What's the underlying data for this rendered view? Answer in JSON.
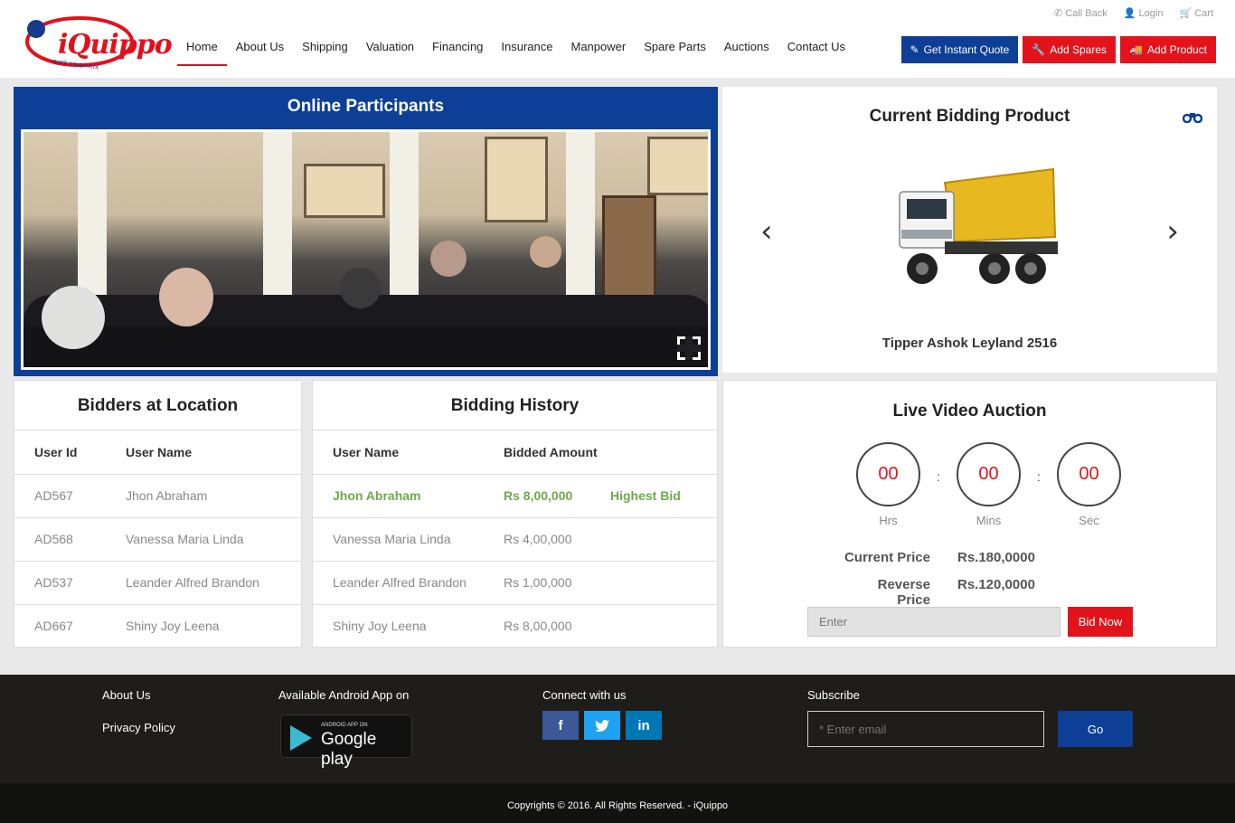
{
  "header": {
    "logo_text": "iQuippo",
    "logo_tagline": "quick equipment",
    "nav": [
      "Home",
      "About Us",
      "Shipping",
      "Valuation",
      "Financing",
      "Insurance",
      "Manpower",
      "Spare Parts",
      "Auctions",
      "Contact Us"
    ],
    "active_nav": "Home",
    "toplinks": {
      "call_back": "Call Back",
      "login": "Login",
      "cart": "Cart"
    },
    "buttons": {
      "quote": "Get Instant Quote",
      "spares": "Add Spares",
      "product": "Add Product"
    }
  },
  "online": {
    "title": "Online Participants"
  },
  "current": {
    "title": "Current Bidding Product",
    "product_name": "Tipper Ashok Leyland 2516"
  },
  "bidders": {
    "title": "Bidders at Location",
    "headers": [
      "User Id",
      "User Name"
    ],
    "rows": [
      [
        "AD567",
        "Jhon Abraham"
      ],
      [
        "AD568",
        "Vanessa Maria Linda"
      ],
      [
        "AD537",
        "Leander Alfred Brandon"
      ],
      [
        "AD667",
        "Shiny Joy Leena"
      ]
    ]
  },
  "history": {
    "title": "Bidding History",
    "headers": [
      "User Name",
      "Bidded Amount",
      ""
    ],
    "rows": [
      [
        "Jhon Abraham",
        "Rs 8,00,000",
        "Highest Bid"
      ],
      [
        "Vanessa Maria Linda",
        "Rs 4,00,000",
        ""
      ],
      [
        "Leander Alfred Brandon",
        "Rs 1,00,000",
        ""
      ],
      [
        "Shiny Joy Leena",
        "Rs 8,00,000",
        ""
      ]
    ]
  },
  "live": {
    "title": "Live Video Auction",
    "timer": {
      "hrs": "00",
      "mins": "00",
      "sec": "00",
      "hrs_label": "Hrs",
      "mins_label": "Mins",
      "sec_label": "Sec"
    },
    "current_price_label": "Current Price",
    "current_price": "Rs.180,0000",
    "reverse_price_label": "Reverse Price",
    "reverse_price": "Rs.120,0000",
    "bid_placeholder": "Enter",
    "bid_button": "Bid Now"
  },
  "footer": {
    "about": "About Us",
    "privacy": "Privacy Policy",
    "app_heading": "Available Android App on",
    "gplay_small": "ANDROID APP ON",
    "gplay_big": "Google play",
    "connect_heading": "Connect with us",
    "social": {
      "facebook": "f",
      "twitter": "t",
      "linkedin": "in"
    },
    "subscribe_heading": "Subscribe",
    "email_placeholder": "* Enter email",
    "go_button": "Go",
    "copyright": "Copyrights © 2016. All Rights Reserved. - iQuippo"
  },
  "colors": {
    "brand_blue": "#0c3f95",
    "brand_red": "#e3131c",
    "highlight_green": "#6ea84d"
  }
}
